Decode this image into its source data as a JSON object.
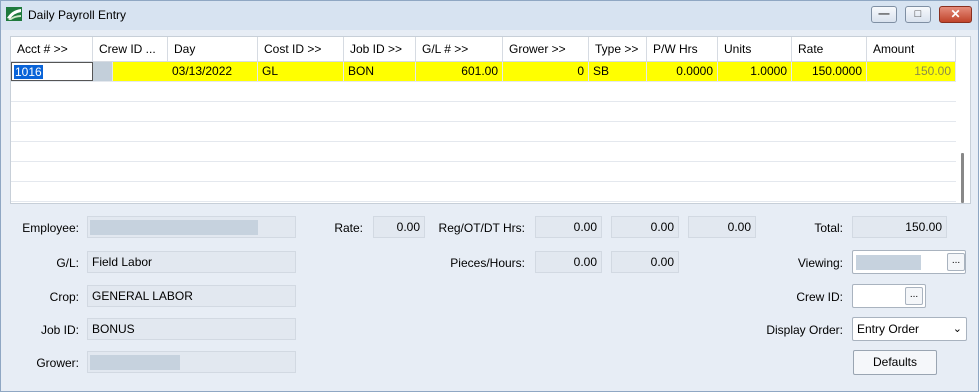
{
  "window": {
    "title": "Daily Payroll Entry",
    "controls": {
      "minimize": "—",
      "maximize": "□",
      "close": "✕"
    }
  },
  "grid": {
    "columns": [
      "Acct # >>",
      "Crew ID ...",
      "Day",
      "Cost ID >>",
      "Job ID >>",
      "G/L # >>",
      "Grower >>",
      "Type >>",
      "P/W Hrs",
      "Units",
      "Rate",
      "Amount"
    ],
    "rows": [
      {
        "acct": "1016",
        "crew_id": "",
        "day": "03/13/2022",
        "cost_id": "GL",
        "job_id": "BON",
        "gl": "601.00",
        "grower": "0",
        "type": "SB",
        "pw_hrs": "0.0000",
        "units": "1.0000",
        "rate": "150.0000",
        "amount": "150.00"
      }
    ]
  },
  "details": {
    "employee_label": "Employee:",
    "gl_label": "G/L:",
    "gl_value": "Field Labor",
    "crop_label": "Crop:",
    "crop_value": "GENERAL LABOR",
    "jobid_label": "Job ID:",
    "jobid_value": "BONUS",
    "grower_label": "Grower:",
    "rate_label": "Rate:",
    "rate_value": "0.00",
    "reg_label": "Reg/OT/DT Hrs:",
    "reg_value": "0.00",
    "ot_value": "0.00",
    "dt_value": "0.00",
    "pieces_label": "Pieces/Hours:",
    "pieces_value": "0.00",
    "hours_value": "0.00",
    "total_label": "Total:",
    "total_value": "150.00",
    "viewing_label": "Viewing:",
    "crewid_label": "Crew ID:",
    "display_order_label": "Display Order:",
    "display_order_value": "Entry Order",
    "defaults_button": "Defaults",
    "ellipsis": "..."
  }
}
